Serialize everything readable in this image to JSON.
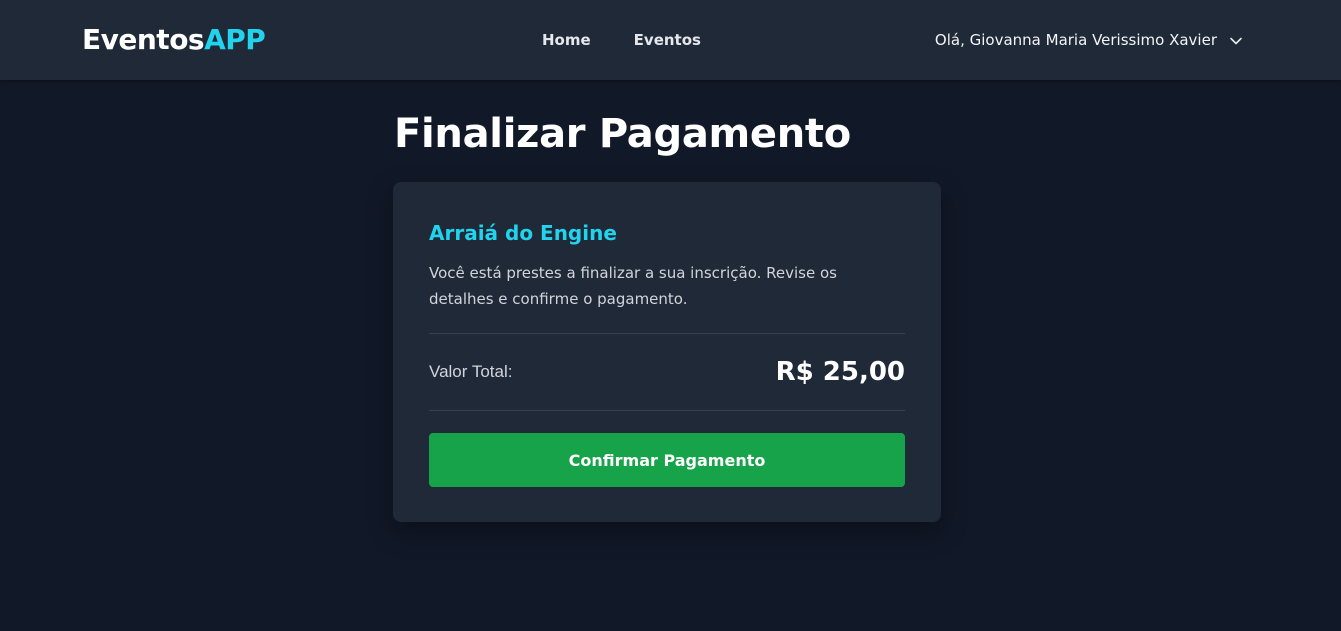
{
  "navbar": {
    "brand_main": "Eventos",
    "brand_accent": "APP",
    "links": [
      {
        "label": "Home"
      },
      {
        "label": "Eventos"
      }
    ],
    "user_greeting": "Olá, Giovanna Maria Verissimo Xavier",
    "user_menu_icon": "chevron-down-icon"
  },
  "page": {
    "title": "Finalizar Pagamento"
  },
  "card": {
    "event_name": "Arraiá do Engine",
    "description": "Você está prestes a finalizar a sua inscrição. Revise os detalhes e confirme o pagamento.",
    "total_label": "Valor Total:",
    "total_value": "R$ 25,00",
    "confirm_label": "Confirmar Pagamento"
  },
  "colors": {
    "background": "#111827",
    "navbar": "#1f2937",
    "card": "#1f2937",
    "accent": "#22d3ee",
    "confirm_button": "#16a34a"
  }
}
